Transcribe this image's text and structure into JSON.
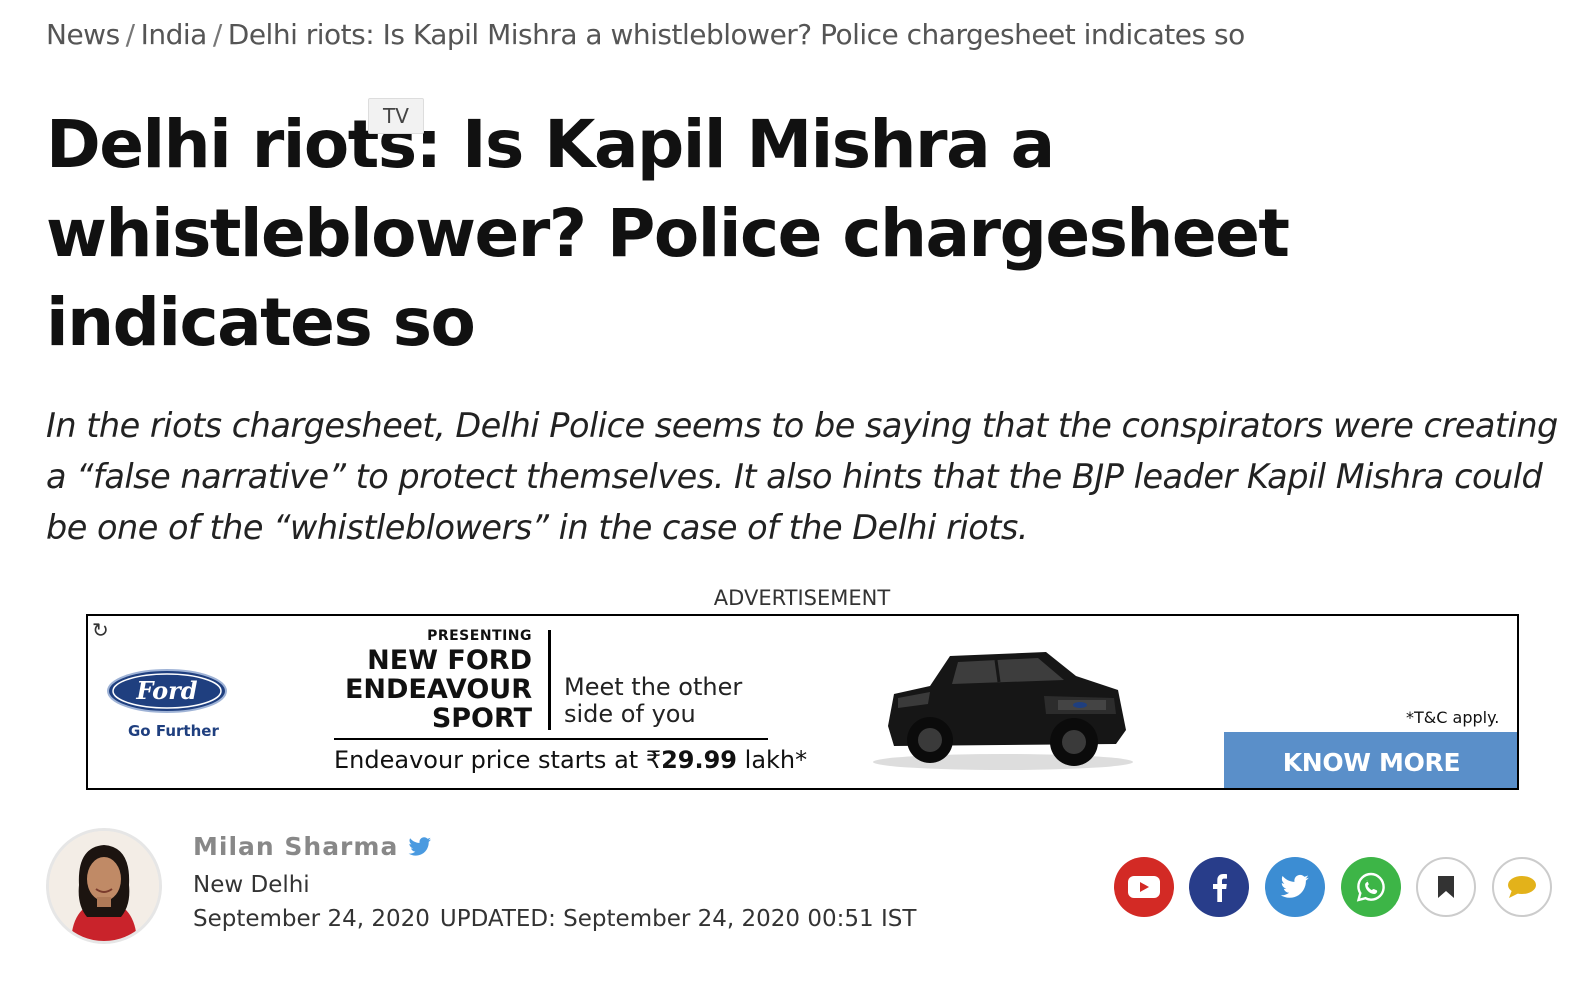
{
  "breadcrumb": {
    "items": [
      "News",
      "India",
      "Delhi riots: Is Kapil Mishra a whistleblower? Police chargesheet indicates so"
    ],
    "separator": "/"
  },
  "article": {
    "headline": "Delhi riots: Is Kapil Mishra a whistleblower? Police chargesheet indicates so",
    "summary": "In the riots chargesheet, Delhi Police seems to be saying that the conspirators were creating a “false narrative” to protect themselves. It also hints that the BJP leader Kapil Mishra could be one of the “whistleblowers” in the case of the Delhi riots."
  },
  "tooltip": {
    "text": "TV"
  },
  "advertisement": {
    "label": "ADVERTISEMENT",
    "brand_logo_text": "Ford",
    "brand_tagline": "Go Further",
    "presenting": "PRESENTING",
    "model_lines": [
      "NEW FORD",
      "ENDEAVOUR",
      "SPORT"
    ],
    "tagline_lines": [
      "Meet the other",
      "side of you"
    ],
    "price_prefix": "Endeavour price starts at ₹",
    "price_value": "29.99",
    "price_suffix": " lakh*",
    "tc": "*T&C apply.",
    "cta": "KNOW MORE",
    "colors": {
      "cta": "#5a8fc9",
      "ford_blue": "#1f3f7f"
    }
  },
  "author": {
    "name": "Milan Sharma",
    "location": "New Delhi",
    "published": "September 24, 2020",
    "updated": "UPDATED: September 24, 2020 00:51 IST"
  },
  "social": {
    "icons": [
      "youtube-icon",
      "facebook-icon",
      "twitter-icon",
      "whatsapp-icon",
      "bookmark-icon",
      "comment-icon"
    ],
    "colors": {
      "youtube": "#d32a25",
      "facebook": "#283d8a",
      "twitter": "#3c8dd3",
      "whatsapp": "#3db547"
    }
  }
}
